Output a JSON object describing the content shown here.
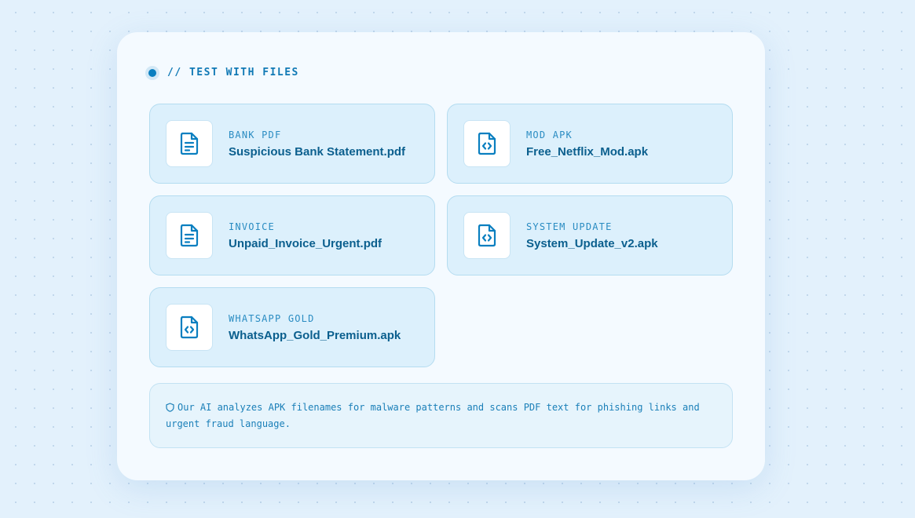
{
  "header": {
    "label": "// TEST WITH FILES"
  },
  "files": [
    {
      "tag": "BANK PDF",
      "name": "Suspicious Bank Statement.pdf",
      "icon": "file-text-icon"
    },
    {
      "tag": "MOD APK",
      "name": "Free_Netflix_Mod.apk",
      "icon": "file-code-icon"
    },
    {
      "tag": "INVOICE",
      "name": "Unpaid_Invoice_Urgent.pdf",
      "icon": "file-text-icon"
    },
    {
      "tag": "SYSTEM UPDATE",
      "name": "System_Update_v2.apk",
      "icon": "file-code-icon"
    },
    {
      "tag": "WHATSAPP GOLD",
      "name": "WhatsApp_Gold_Premium.apk",
      "icon": "file-code-icon"
    }
  ],
  "note": {
    "icon": "shield-icon",
    "text": "Our AI analyzes APK filenames for malware patterns and scans PDF text for phishing links and urgent fraud language."
  },
  "colors": {
    "accent": "#0a7fc0",
    "card_bg": "#dcf0fc",
    "title_text": "#0b5f8e"
  }
}
